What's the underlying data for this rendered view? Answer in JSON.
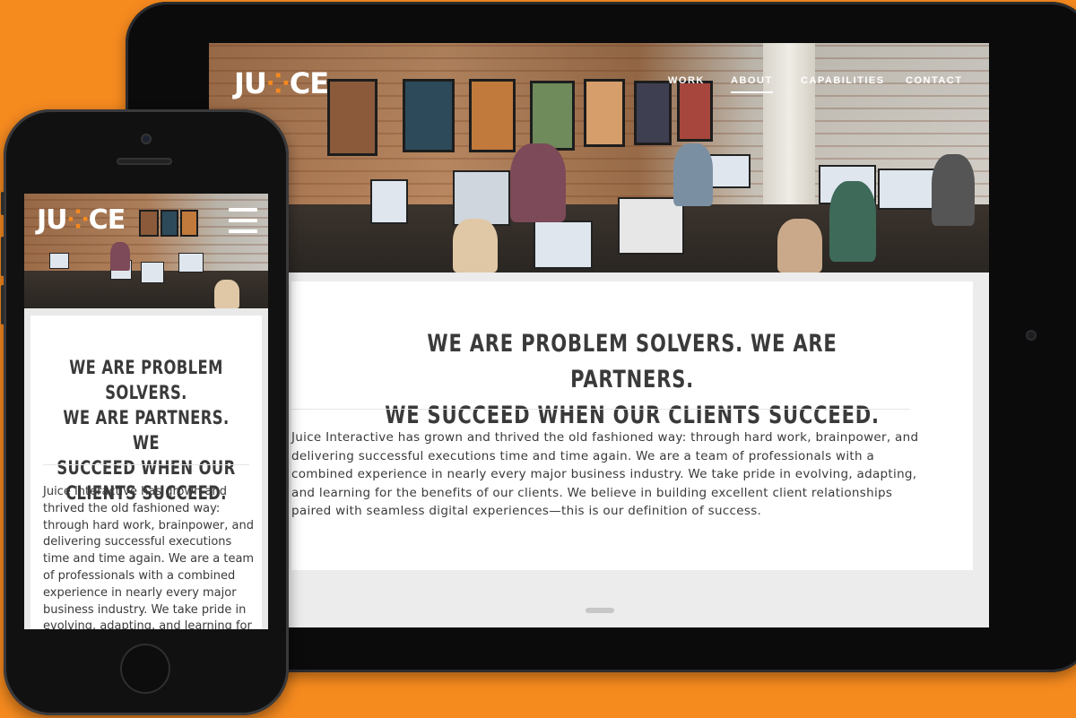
{
  "brand": {
    "logo_text_left": "JU",
    "logo_dots": "⁘",
    "logo_text_right": "CE",
    "accent_color": "#f58a1f"
  },
  "tablet": {
    "nav": {
      "items": [
        {
          "label": "WORK",
          "active": false
        },
        {
          "label": "ABOUT",
          "active": true
        },
        {
          "label": "CAPABILITIES",
          "active": false
        },
        {
          "label": "CONTACT",
          "active": false
        }
      ]
    },
    "headline_line1": "WE ARE PROBLEM SOLVERS. WE ARE PARTNERS.",
    "headline_line2": "WE SUCCEED WHEN OUR CLIENTS SUCCEED.",
    "body": "Juice Interactive has grown and thrived the old fashioned way: through hard work, brainpower, and delivering successful executions time and time again. We are a team of professionals with a combined experience in nearly every major business industry. We take pride in evolving, adapting, and learning for the benefits of our clients. We believe in building excellent client relationships paired with seamless digital experiences—this is our definition of success."
  },
  "phone": {
    "menu_icon": "hamburger-menu-icon",
    "headline_line1": "WE ARE PROBLEM SOLVERS.",
    "headline_line2": "WE ARE PARTNERS. WE",
    "headline_line3": "SUCCEED WHEN OUR",
    "headline_line4": "CLIENTS SUCCEED.",
    "body": "Juice Interactive has grown and thrived the old fashioned way: through hard work, brainpower, and delivering successful executions time and time again. We are a team of professionals with a combined experience in nearly every major business industry. We take pride in evolving, adapting, and learning for"
  }
}
